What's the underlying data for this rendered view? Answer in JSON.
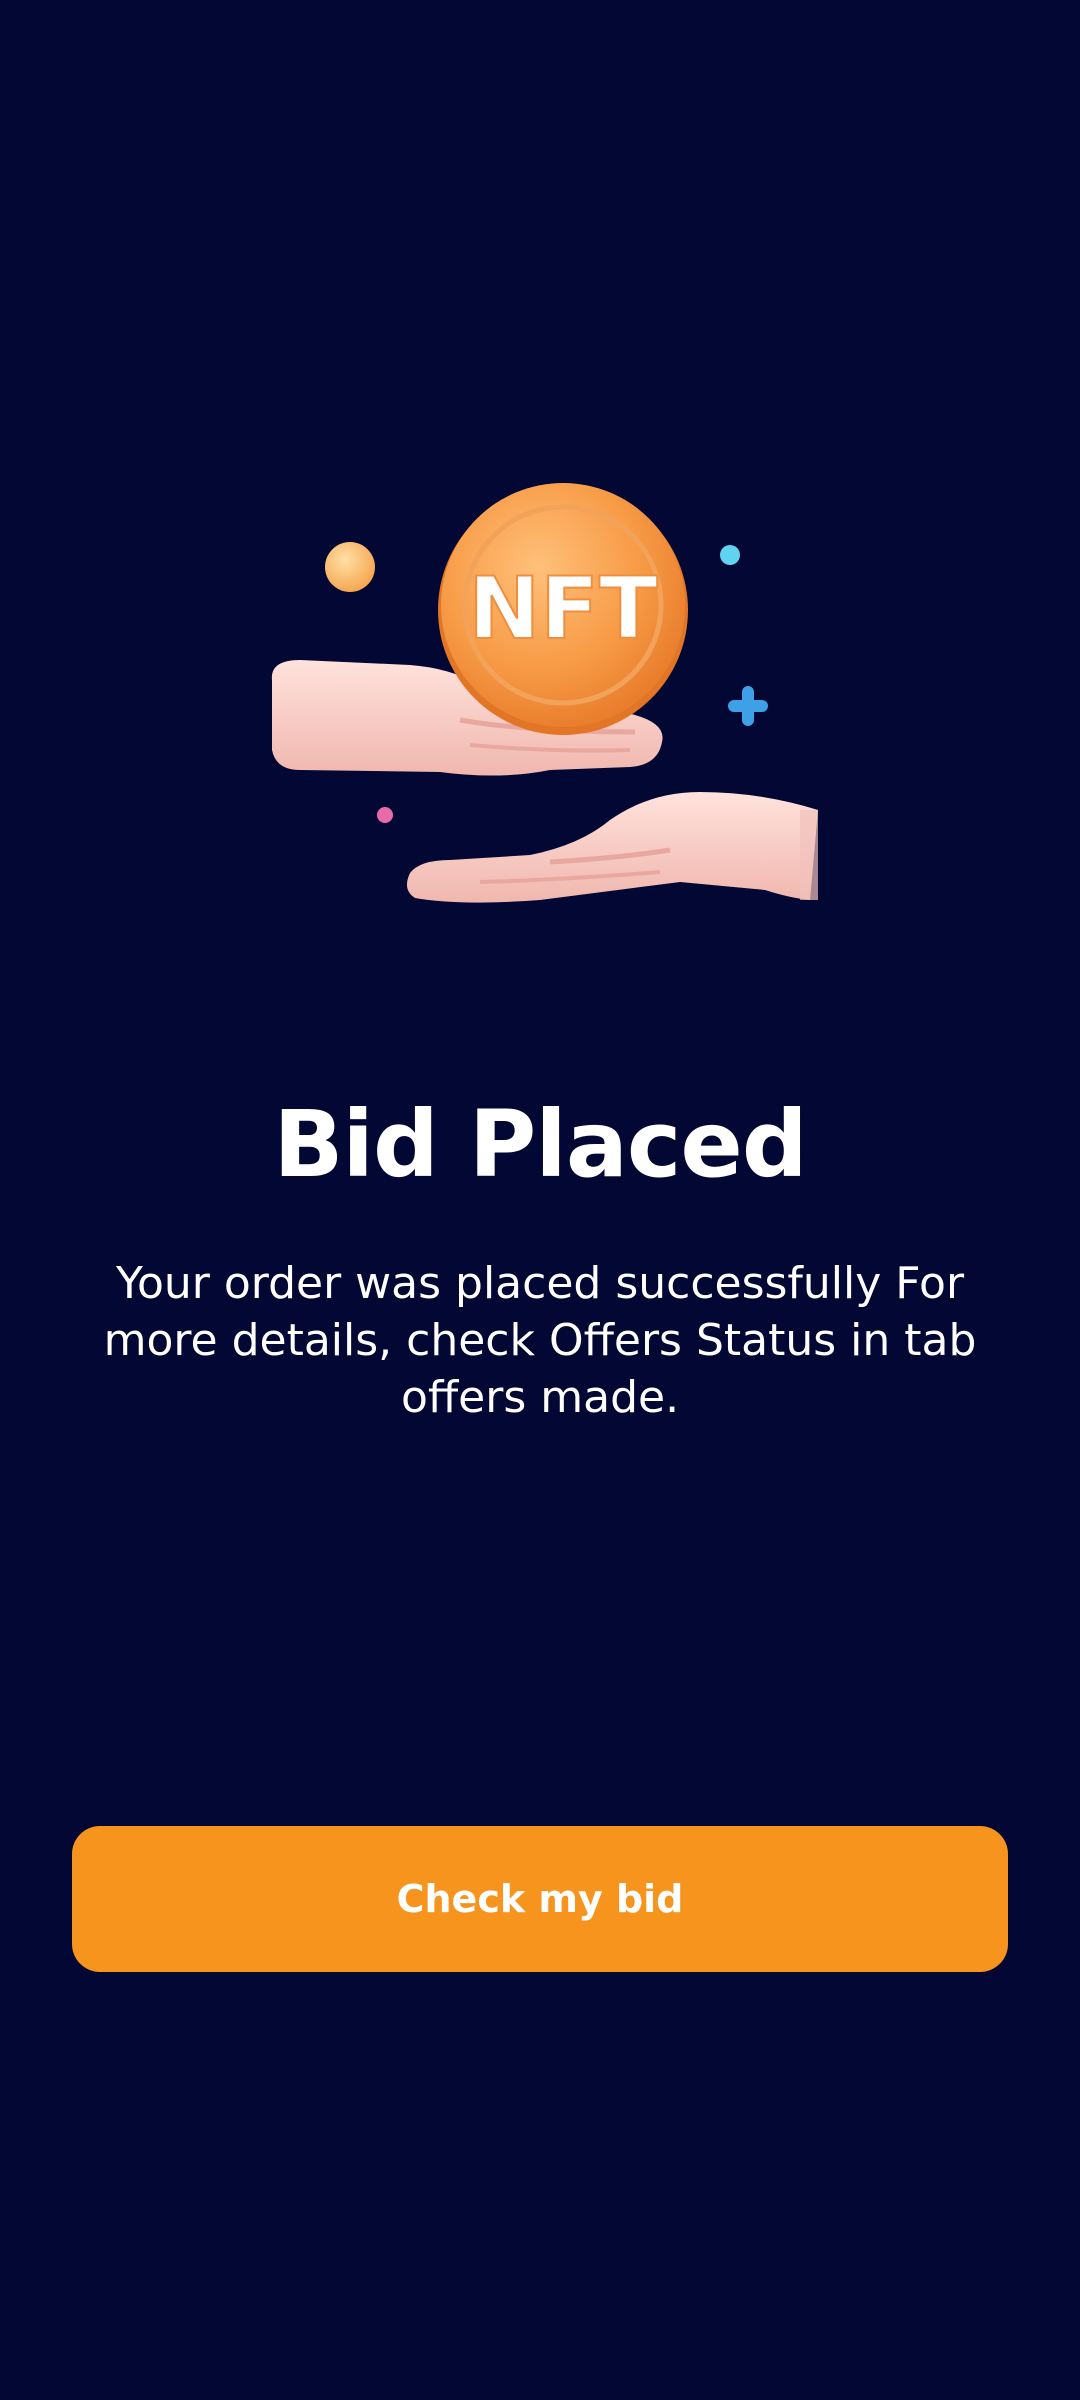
{
  "illustration": {
    "icon": "nft-coin-hands-icon",
    "coin_label": "NFT"
  },
  "title": "Bid Placed",
  "description": "Your order was placed successfully For more details, check Offers Status in tab offers made.",
  "primary_button": {
    "label": "Check my bid"
  },
  "colors": {
    "background": "#030733",
    "accent": "#f7941e",
    "text": "#ffffff"
  }
}
